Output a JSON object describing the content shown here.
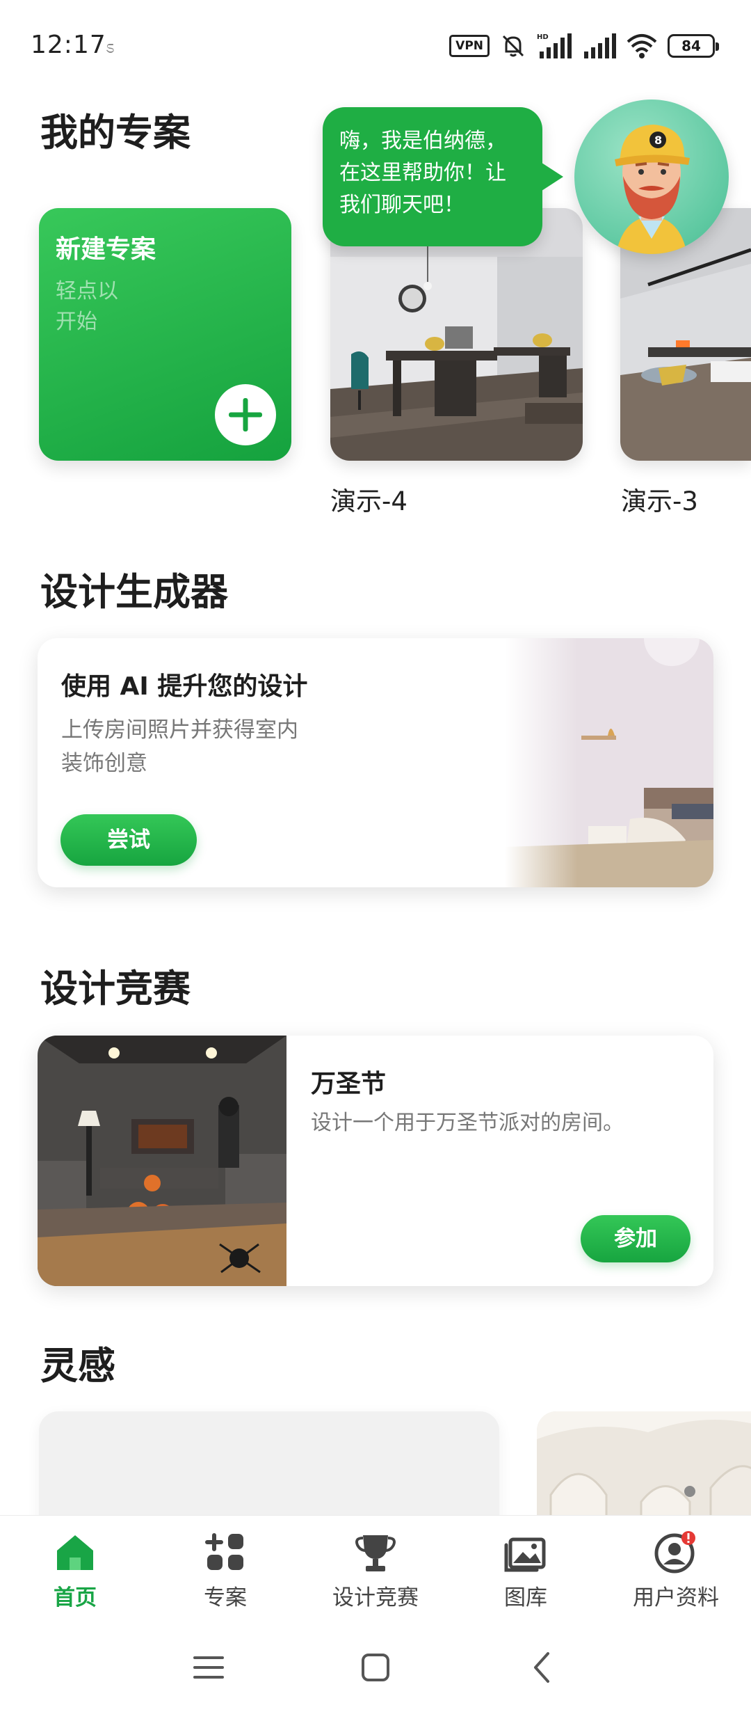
{
  "status_bar": {
    "time": "12:17",
    "vpn": "VPN",
    "network": "HD",
    "battery": "84"
  },
  "projects": {
    "title": "我的专案",
    "new_project_title": "新建专案",
    "new_project_subtitle": "轻点以开始",
    "items": [
      {
        "label": "演示-4"
      },
      {
        "label": "演示-3"
      }
    ]
  },
  "assistant": {
    "message": "嗨，我是伯纳德，在这里帮助你！让我们聊天吧！"
  },
  "generator": {
    "title": "设计生成器",
    "card_title": "使用 AI 提升您的设计",
    "card_subtitle": "上传房间照片并获得室内装饰创意",
    "button": "尝试"
  },
  "contest": {
    "title": "设计竞赛",
    "card_title": "万圣节",
    "card_desc": "设计一个用于万圣节派对的房间。",
    "button": "参加"
  },
  "inspiration": {
    "title": "灵感"
  },
  "bottom_nav": {
    "items": [
      {
        "label": "首页",
        "icon": "home-icon",
        "active": true
      },
      {
        "label": "专案",
        "icon": "projects-icon"
      },
      {
        "label": "设计竞赛",
        "icon": "trophy-icon"
      },
      {
        "label": "图库",
        "icon": "gallery-icon"
      },
      {
        "label": "用户资料",
        "icon": "profile-icon"
      }
    ]
  },
  "colors": {
    "accent": "#19a546",
    "accent_light": "#34c757"
  }
}
